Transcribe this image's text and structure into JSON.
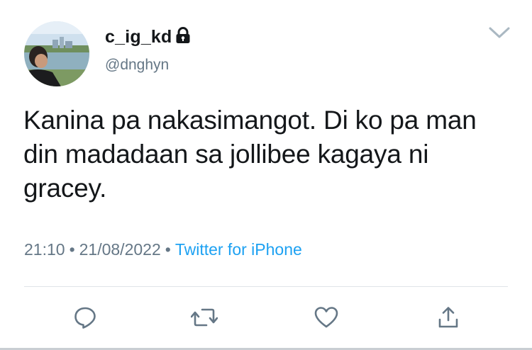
{
  "user": {
    "display_name": "c_ig_kd",
    "handle": "@dnghyn",
    "protected_icon": "lock-icon",
    "avatar": "profile-photo"
  },
  "tweet": {
    "text": "Kanina pa nakasimangot. Di ko pa man din madadaan sa jollibee kagaya ni gracey.",
    "time": "21:10",
    "date": "21/08/2022",
    "source": "Twitter for iPhone",
    "separator": "•"
  },
  "menu": {
    "icon": "chevron-down-icon"
  },
  "actions": [
    "reply-icon",
    "retweet-icon",
    "like-icon",
    "share-icon"
  ],
  "colors": {
    "link": "#1da1f2",
    "muted": "#657786",
    "text": "#14171a"
  }
}
